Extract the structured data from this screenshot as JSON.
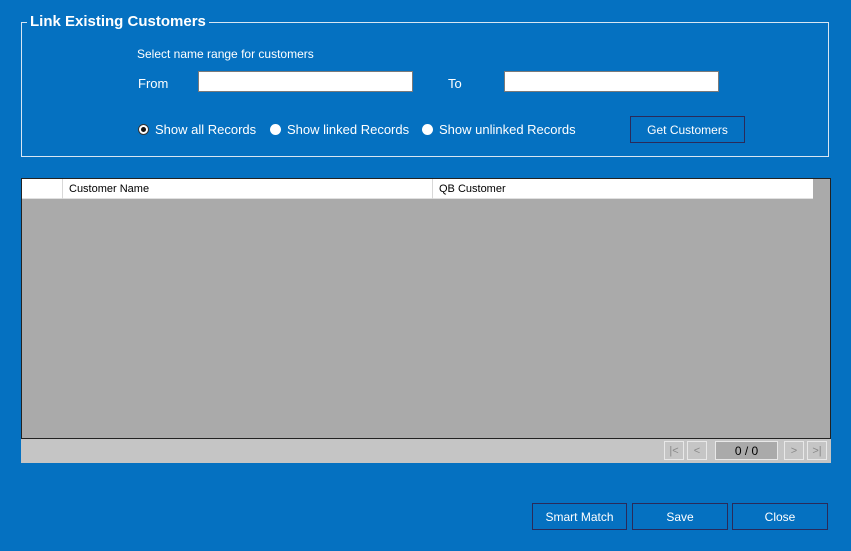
{
  "group": {
    "title": "Link Existing Customers",
    "range_label": "Select name range for customers",
    "from_label": "From",
    "to_label": "To",
    "from_value": "",
    "to_value": ""
  },
  "filters": {
    "options": [
      {
        "label": "Show all Records",
        "checked": true
      },
      {
        "label": "Show linked Records",
        "checked": false
      },
      {
        "label": "Show unlinked Records",
        "checked": false
      }
    ],
    "get_button": "Get Customers"
  },
  "grid": {
    "columns": [
      "",
      "Customer Name",
      "QB Customer"
    ],
    "rows": []
  },
  "pager": {
    "first": "|<",
    "prev": "<",
    "position": "0 / 0",
    "next": ">",
    "last": ">|"
  },
  "actions": {
    "smart_match": "Smart Match",
    "save": "Save",
    "close": "Close"
  },
  "colors": {
    "background": "#0571C1",
    "grid_body": "#AAAAAA",
    "pager_bar": "#C5C5C5"
  }
}
